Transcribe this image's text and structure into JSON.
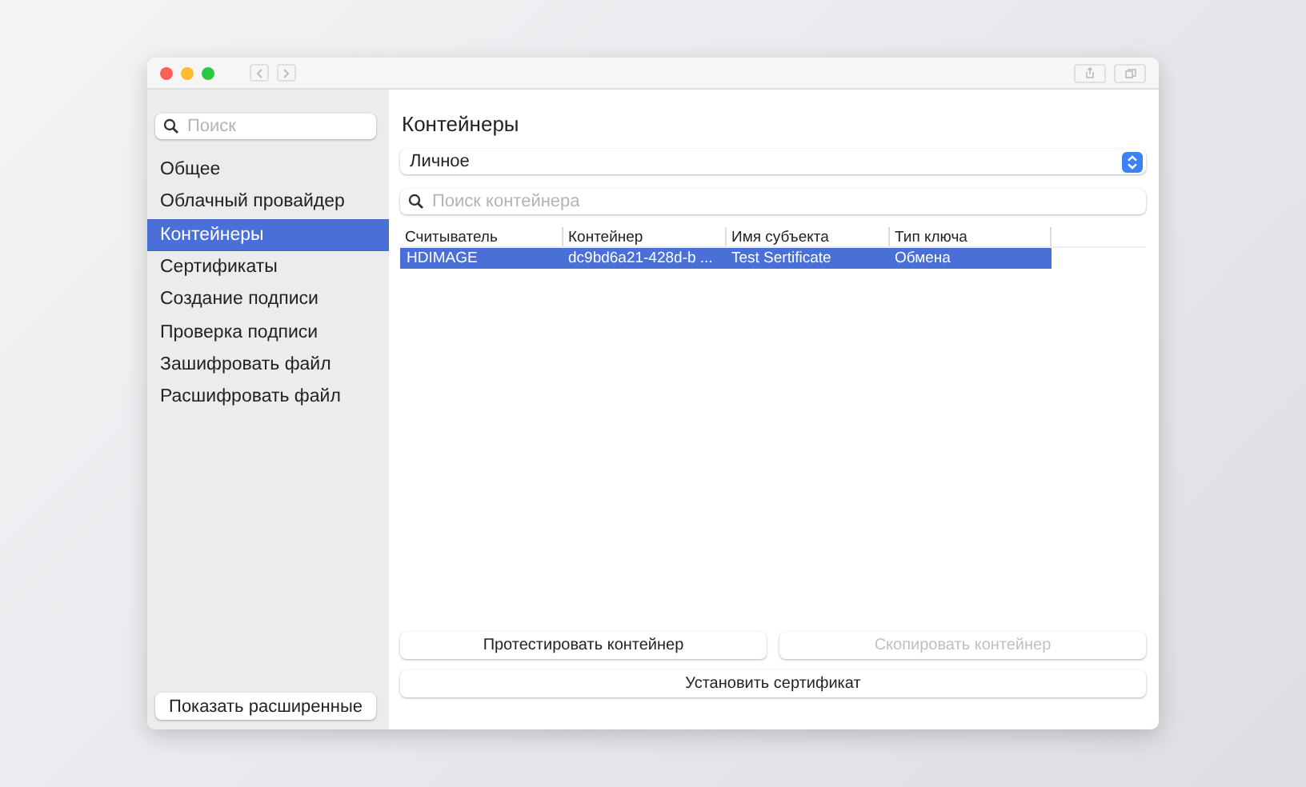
{
  "sidebar": {
    "search": {
      "placeholder": "Поиск"
    },
    "items": [
      {
        "label": "Общее",
        "selected": false
      },
      {
        "label": "Облачный провайдер",
        "selected": false
      },
      {
        "label": "Контейнеры",
        "selected": true
      },
      {
        "label": "Сертификаты",
        "selected": false
      },
      {
        "label": "Создание подписи",
        "selected": false
      },
      {
        "label": "Проверка подписи",
        "selected": false
      },
      {
        "label": "Зашифровать файл",
        "selected": false
      },
      {
        "label": "Расшифровать файл",
        "selected": false
      }
    ],
    "button": "Показать расширенные"
  },
  "main": {
    "title": "Контейнеры",
    "store_select": "Личное",
    "search": {
      "placeholder": "Поиск контейнера"
    },
    "table": {
      "columns": [
        "Считыватель",
        "Контейнер",
        "Имя субъекта",
        "Тип ключа"
      ],
      "rows": [
        {
          "cells": [
            "HDIMAGE",
            "dc9bd6a21-428d-b ...",
            "Test Sertificate",
            "Обмена"
          ],
          "selected": true
        }
      ]
    },
    "buttons": [
      {
        "label": "Протестировать контейнер",
        "disabled": false
      },
      {
        "label": "Скопировать контейнер",
        "disabled": true
      },
      {
        "label": "Установить сертификат",
        "disabled": false
      }
    ]
  }
}
